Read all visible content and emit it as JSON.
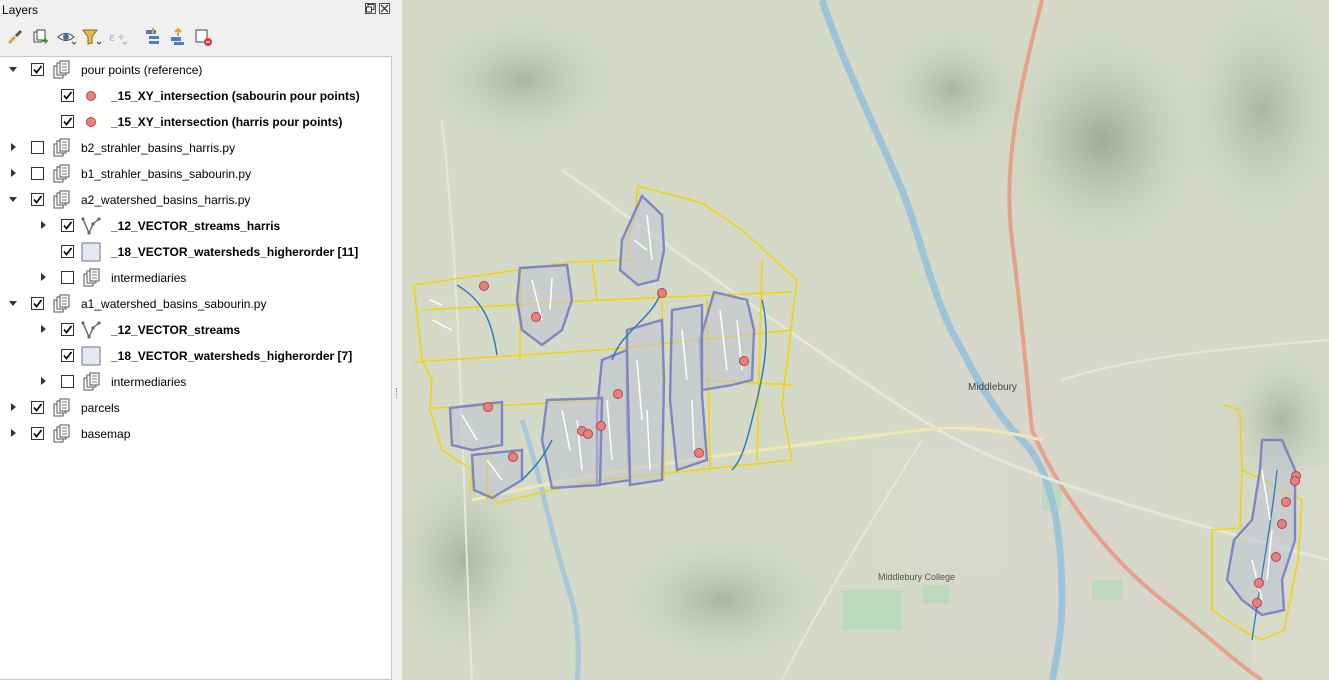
{
  "panel": {
    "title": "Layers"
  },
  "toolbar": {
    "buttons": [
      {
        "icon": "style-brush-icon"
      },
      {
        "icon": "add-group-icon"
      },
      {
        "icon": "visibility-eye-icon"
      },
      {
        "icon": "filter-icon"
      },
      {
        "icon": "expression-filter-icon"
      },
      {
        "icon": "expand-all-icon"
      },
      {
        "icon": "collapse-all-icon"
      },
      {
        "icon": "remove-layer-icon"
      }
    ]
  },
  "layers": [
    {
      "label": "pour points (reference)",
      "type": "group",
      "checked": true,
      "expanded": true,
      "bold": false,
      "indent": 0
    },
    {
      "label": "_15_XY_intersection (sabourin pour points)",
      "type": "point",
      "checked": true,
      "bold": true,
      "indent": 1
    },
    {
      "label": "_15_XY_intersection (harris pour points)",
      "type": "point",
      "checked": true,
      "bold": true,
      "indent": 1
    },
    {
      "label": "b2_strahler_basins_harris.py",
      "type": "group",
      "checked": false,
      "expanded": false,
      "bold": false,
      "indent": 0
    },
    {
      "label": "b1_strahler_basins_sabourin.py",
      "type": "group",
      "checked": false,
      "expanded": false,
      "bold": false,
      "indent": 0
    },
    {
      "label": "a2_watershed_basins_harris.py",
      "type": "group",
      "checked": true,
      "expanded": true,
      "bold": false,
      "indent": 0
    },
    {
      "label": "_12_VECTOR_streams_harris",
      "type": "line",
      "checked": true,
      "expanded": false,
      "bold": true,
      "indent": 1
    },
    {
      "label": "_18_VECTOR_watersheds_higherorder [11]",
      "type": "polygon",
      "checked": true,
      "bold": true,
      "indent": 1
    },
    {
      "label": "intermediaries",
      "type": "group",
      "checked": false,
      "expanded": false,
      "bold": false,
      "indent": 1
    },
    {
      "label": "a1_watershed_basins_sabourin.py",
      "type": "group",
      "checked": true,
      "expanded": true,
      "bold": false,
      "indent": 0
    },
    {
      "label": "_12_VECTOR_streams",
      "type": "line",
      "checked": true,
      "expanded": false,
      "bold": true,
      "indent": 1
    },
    {
      "label": "_18_VECTOR_watersheds_higherorder [7]",
      "type": "polygon",
      "checked": true,
      "bold": true,
      "indent": 1
    },
    {
      "label": "intermediaries",
      "type": "group",
      "checked": false,
      "expanded": false,
      "bold": false,
      "indent": 1
    },
    {
      "label": "parcels",
      "type": "group",
      "checked": true,
      "expanded": false,
      "bold": false,
      "indent": 0
    },
    {
      "label": "basemap",
      "type": "group",
      "checked": true,
      "expanded": false,
      "bold": false,
      "indent": 0
    }
  ],
  "colors": {
    "point_fill": "#e88080",
    "point_stroke": "#b34545",
    "parcel_outline": "#f2d40d",
    "watershed_outline": "#7f86c2",
    "stream_white": "#ffffff",
    "stream_blue": "#2d7fb8",
    "polygon_symbol_fill": "#e4e8f4"
  },
  "map": {
    "labels": [
      "Middlebury",
      "Middlebury College"
    ]
  }
}
